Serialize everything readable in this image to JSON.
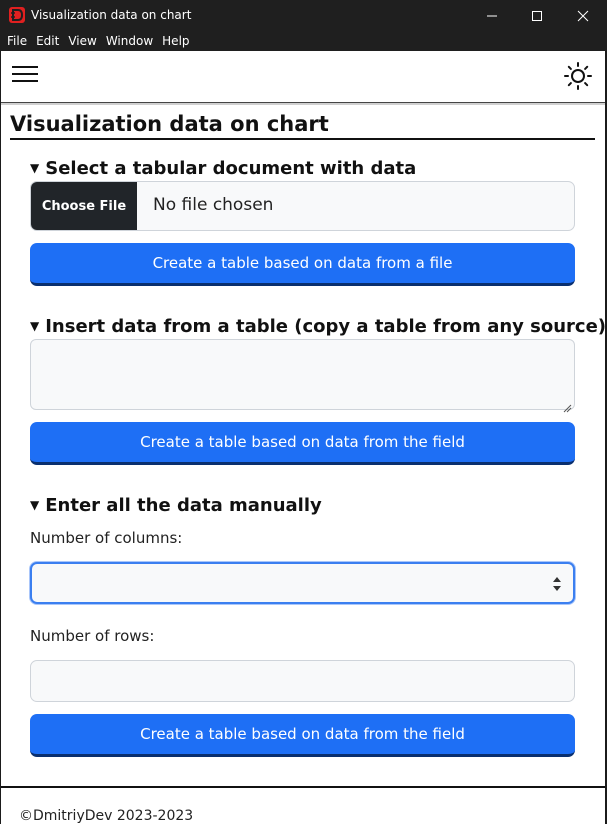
{
  "window": {
    "title": "Visualization data on chart"
  },
  "menu": {
    "items": [
      "File",
      "Edit",
      "View",
      "Window",
      "Help"
    ]
  },
  "navbar": {
    "menu_icon": "hamburger-icon",
    "theme_icon": "sun-icon"
  },
  "page": {
    "title": "Visualization data on chart"
  },
  "sections": {
    "file": {
      "title": "Select a tabular document with data",
      "choose_label": "Choose File",
      "status": "No file chosen",
      "button": "Create a table based on data from a file"
    },
    "paste": {
      "title": "Insert data from a table (copy a table from any source)",
      "button": "Create a table based on data from the field"
    },
    "manual": {
      "title": "Enter all the data manually",
      "columns_label": "Number of columns:",
      "rows_label": "Number of rows:",
      "button": "Create a table based on data from the field"
    }
  },
  "footer": {
    "text": "©DmitriyDev 2023-2023"
  },
  "colors": {
    "accent": "#1e6ff5",
    "dark": "#212529",
    "titlebar": "#1f1f1f"
  }
}
